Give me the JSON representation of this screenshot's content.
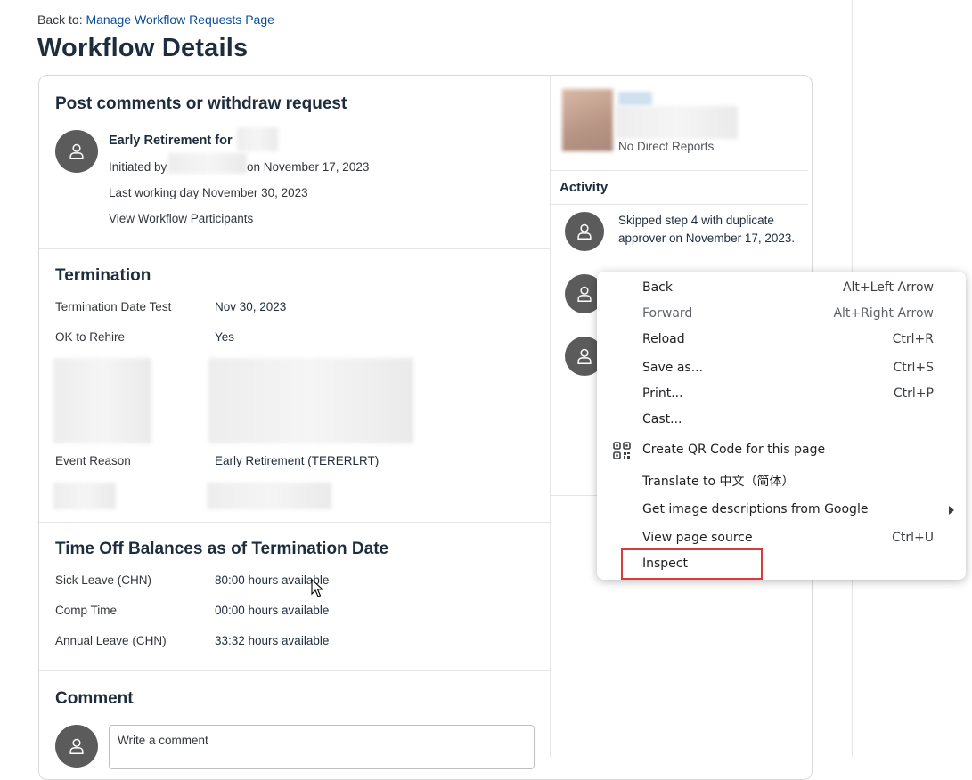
{
  "breadcrumb": {
    "prefix": "Back to:",
    "link": "Manage Workflow Requests Page"
  },
  "page_title": "Workflow Details",
  "post_section": {
    "title": "Post comments or withdraw request",
    "request_title": "Early Retirement for",
    "initiated_prefix": "Initiated by",
    "initiated_date": "on November 17, 2023",
    "last_working_day": "Last working day  November 30, 2023",
    "participants_link": "View Workflow Participants"
  },
  "termination": {
    "title": "Termination",
    "rows": [
      {
        "label": "Termination Date Test",
        "value": "Nov 30, 2023"
      },
      {
        "label": "OK to Rehire",
        "value": "Yes"
      },
      {
        "label": "Event Reason",
        "value": "Early Retirement (TERERLRT)"
      }
    ]
  },
  "time_off": {
    "title": "Time Off Balances as of Termination Date",
    "rows": [
      {
        "label": "Sick Leave (CHN)",
        "value": "80:00 hours available"
      },
      {
        "label": "Comp Time",
        "value": "00:00 hours available"
      },
      {
        "label": "Annual Leave (CHN)",
        "value": "33:32 hours available"
      }
    ]
  },
  "comment": {
    "title": "Comment",
    "placeholder": "Write a comment"
  },
  "profile": {
    "direct_reports": "No Direct Reports"
  },
  "activity": {
    "title": "Activity",
    "items": [
      {
        "text": "Skipped step 4 with duplicate approver on November 17, 2023."
      }
    ]
  },
  "context_menu": {
    "items": [
      {
        "label": "Back",
        "shortcut": "Alt+Left Arrow"
      },
      {
        "label": "Forward",
        "shortcut": "Alt+Right Arrow",
        "disabled": true
      },
      {
        "label": "Reload",
        "shortcut": "Ctrl+R"
      },
      {
        "label": "Save as...",
        "shortcut": "Ctrl+S"
      },
      {
        "label": "Print...",
        "shortcut": "Ctrl+P"
      },
      {
        "label": "Cast...",
        "shortcut": ""
      },
      {
        "label": "Create QR Code for this page",
        "shortcut": "",
        "icon": "qr-code-icon"
      },
      {
        "label": "Translate to 中文（简体）",
        "shortcut": ""
      },
      {
        "label": "Get image descriptions from Google",
        "shortcut": "",
        "submenu": true
      },
      {
        "label": "View page source",
        "shortcut": "Ctrl+U"
      },
      {
        "label": "Inspect",
        "shortcut": "",
        "highlighted": true
      }
    ]
  },
  "colors": {
    "link": "#0a4d9b",
    "title": "#1d2d3e",
    "avatar": "#5b5b5b",
    "highlight": "#d93a3a"
  }
}
